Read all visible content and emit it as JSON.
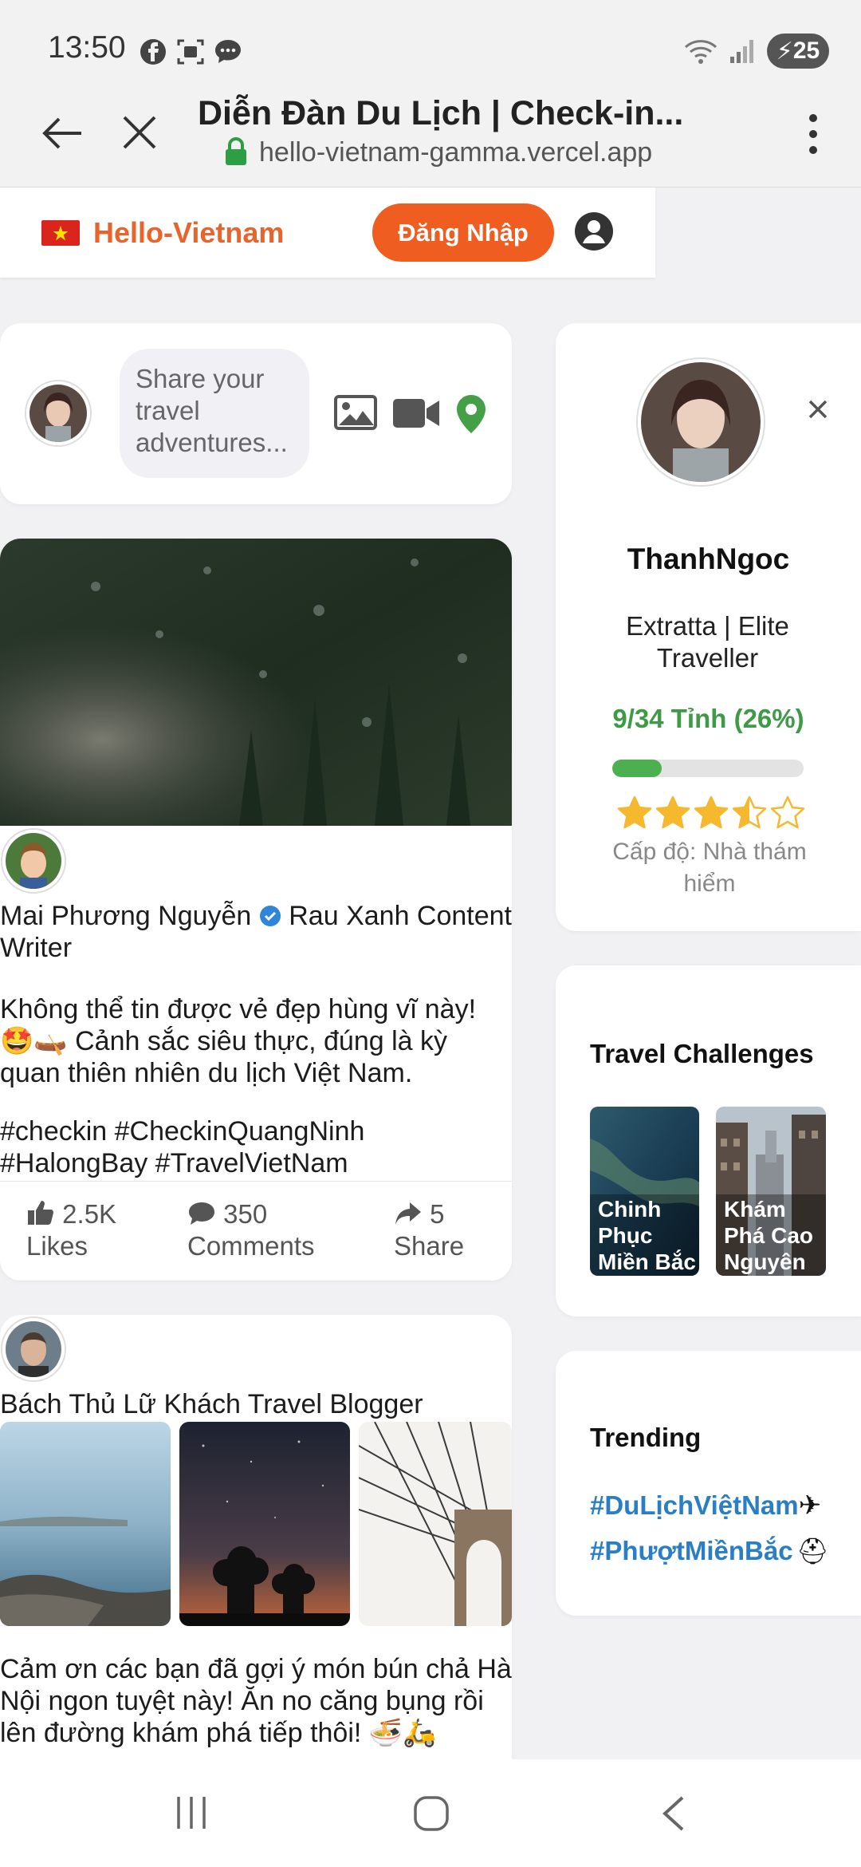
{
  "status_bar": {
    "time": "13:50",
    "battery": "25"
  },
  "browser": {
    "title": "Diễn Đàn Du Lịch | Check-in...",
    "url": "hello-vietnam-gamma.vercel.app"
  },
  "header": {
    "brand": "Hello-Vietnam",
    "login_label": "Đăng Nhập"
  },
  "composer": {
    "placeholder": "Share your travel adventures..."
  },
  "post1": {
    "author": "Mai Phương Nguyễn",
    "role": "Rau Xanh Content Writer",
    "text": "Không thể tin được vẻ đẹp hùng vĩ này! 🤩🛶 Cảnh sắc siêu thực, đúng là kỳ quan thiên nhiên du lịch Việt Nam.",
    "hashtags": "#checkin #CheckinQuangNinh #HalongBay #TravelVietNam",
    "likes_value": "2.5K",
    "likes_label": "Likes",
    "comments_value": "350",
    "comments_label": "Comments",
    "shares_value": "5",
    "shares_label": "Share"
  },
  "post2": {
    "author": "Bách Thủ Lữ Khách",
    "role": "Travel Blogger",
    "text": "Cảm ơn các bạn đã gợi ý món bún chả Hà Nội ngon tuyệt này! Ăn no căng bụng rồi lên đường khám phá tiếp thôi! 🍜🛵"
  },
  "profile": {
    "name": "ThanhNgoc",
    "title": "Extratta | Elite Traveller",
    "progress_text": "9/34 Tỉnh (26%)",
    "progress_fraction": 0.26,
    "rating": 3.5,
    "rating_max": 5,
    "level": "Cấp độ: Nhà thám hiểm"
  },
  "challenges": {
    "title": "Travel Challenges",
    "items": [
      {
        "label": "Chinh Phục Miền Bắc"
      },
      {
        "label": "Khám Phá Cao Nguyên"
      }
    ]
  },
  "trending": {
    "title": "Trending",
    "tags": [
      {
        "tag": "#DuLịchViệtNam",
        "icon": "✈"
      },
      {
        "tag": "#PhượtMiềnBắc",
        "icon": "⛑"
      }
    ]
  },
  "colors": {
    "brand": "#ef5d21",
    "progress_green": "#4caf50",
    "star": "#f5b82e",
    "link_blue": "#2a7fc4",
    "verified": "#2f86d6"
  }
}
